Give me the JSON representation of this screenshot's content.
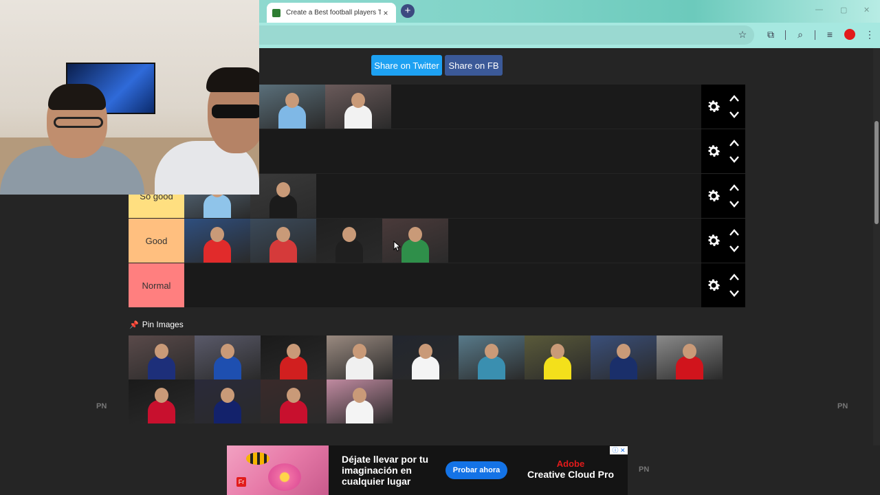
{
  "browser": {
    "tab_title": "Create a Best football players Tier List",
    "tab_close": "×",
    "new_tab": "+"
  },
  "share": {
    "twitter_label": "Share on Twitter",
    "facebook_label": "Share on FB"
  },
  "tiers": [
    {
      "label": "",
      "color": "#1a1a1a",
      "items": [
        {
          "name": "player-messi",
          "kit": "#7fb8e6",
          "bg": "#5a6f7a"
        },
        {
          "name": "player-ronaldo",
          "kit": "#f2f2f2",
          "bg": "#6a5a5a"
        }
      ]
    },
    {
      "label": "",
      "color": "#1a1a1a",
      "items": []
    },
    {
      "label": "So good",
      "color": "#ffdf80",
      "items": [
        {
          "name": "player-aguero",
          "kit": "#8fc4ea",
          "bg": "#5a6f82"
        },
        {
          "name": "player-ederson",
          "kit": "#1b1b1b",
          "bg": "#3a3a3a"
        }
      ]
    },
    {
      "label": "Good",
      "color": "#ffbf7f",
      "items": [
        {
          "name": "player-kane",
          "kit": "#e12b2b",
          "bg": "#2f4f7f"
        },
        {
          "name": "player-griezmann",
          "kit": "#d53a3a",
          "bg": "#3b4a5a"
        },
        {
          "name": "player-placeholder",
          "kit": "#1f1f1f",
          "bg": "#202020"
        },
        {
          "name": "player-de-gea",
          "kit": "#2f8f4a",
          "bg": "#4a3a3a"
        }
      ]
    },
    {
      "label": "Normal",
      "color": "#ff7f7f",
      "items": []
    }
  ],
  "pin": {
    "title": "Pin Images",
    "icon": "pushpin-icon"
  },
  "pool": [
    {
      "name": "pool-icardi",
      "kit": "#1d2f7a",
      "bg": "#5a4a4a"
    },
    {
      "name": "pool-hazard",
      "kit": "#1e4fb0",
      "bg": "#5a5a6a"
    },
    {
      "name": "pool-pogba",
      "kit": "#d11f1f",
      "bg": "#1a1a1a"
    },
    {
      "name": "pool-modric",
      "kit": "#f0f0f0",
      "bg": "#9a8a80"
    },
    {
      "name": "pool-son",
      "kit": "#f4f4f4",
      "bg": "#22262e"
    },
    {
      "name": "pool-neuer",
      "kit": "#3a8fb0",
      "bg": "#587a8a"
    },
    {
      "name": "pool-reus",
      "kit": "#f3e01b",
      "bg": "#5a5a3a"
    },
    {
      "name": "pool-mbappe",
      "kit": "#1a2f6a",
      "bg": "#3a4f7a"
    },
    {
      "name": "pool-lewandowski",
      "kit": "#d1141c",
      "bg": "#8a8a8a"
    },
    {
      "name": "pool-mane",
      "kit": "#c8102e",
      "bg": "#1a1a1a"
    },
    {
      "name": "pool-neymar",
      "kit": "#13226b",
      "bg": "#2a2a3a"
    },
    {
      "name": "pool-salah",
      "kit": "#c8102e",
      "bg": "#3a2a2a"
    },
    {
      "name": "pool-varane",
      "kit": "#f4f4f4",
      "bg": "#c08aa0"
    }
  ],
  "pn_left": "PN",
  "pn_right": "PN",
  "ad": {
    "headline": "Déjate llevar por tu imaginación en cualquier lugar",
    "cta": "Probar ahora",
    "brand_top": "Adobe",
    "brand_bottom": "Creative Cloud Pro",
    "pn": "PN"
  },
  "colors": {
    "twitter": "#1da1f2",
    "facebook": "#3b5998"
  }
}
